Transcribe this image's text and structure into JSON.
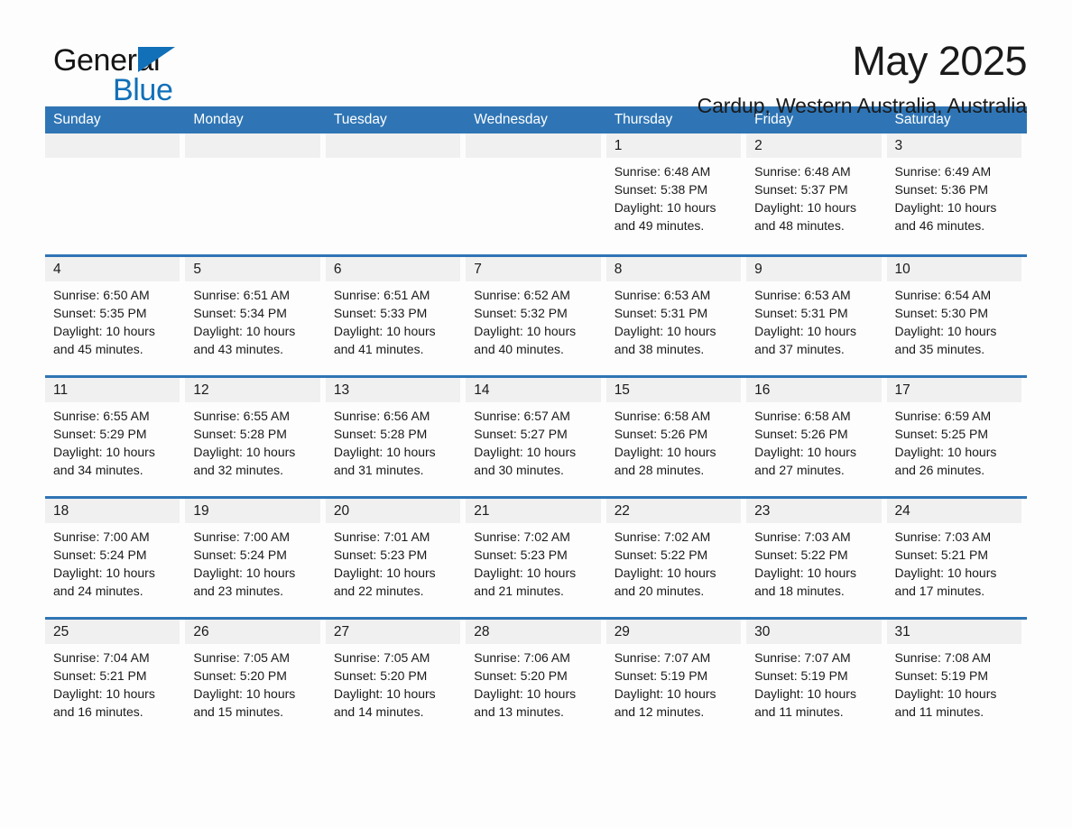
{
  "brand": {
    "name_part1": "General",
    "name_part2": "Blue",
    "logo_icon": "triangle-icon",
    "accent_color": "#1170b8"
  },
  "header": {
    "month_title": "May 2025",
    "location": "Cardup, Western Australia, Australia"
  },
  "calendar": {
    "header_bg_color": "#2f75b5",
    "day_band_color": "#f0f0f0",
    "weekdays": [
      "Sunday",
      "Monday",
      "Tuesday",
      "Wednesday",
      "Thursday",
      "Friday",
      "Saturday"
    ],
    "weeks": [
      [
        {
          "empty": true
        },
        {
          "empty": true
        },
        {
          "empty": true
        },
        {
          "empty": true
        },
        {
          "day": "1",
          "sunrise": "Sunrise: 6:48 AM",
          "sunset": "Sunset: 5:38 PM",
          "daylight_line1": "Daylight: 10 hours",
          "daylight_line2": "and 49 minutes."
        },
        {
          "day": "2",
          "sunrise": "Sunrise: 6:48 AM",
          "sunset": "Sunset: 5:37 PM",
          "daylight_line1": "Daylight: 10 hours",
          "daylight_line2": "and 48 minutes."
        },
        {
          "day": "3",
          "sunrise": "Sunrise: 6:49 AM",
          "sunset": "Sunset: 5:36 PM",
          "daylight_line1": "Daylight: 10 hours",
          "daylight_line2": "and 46 minutes."
        }
      ],
      [
        {
          "day": "4",
          "sunrise": "Sunrise: 6:50 AM",
          "sunset": "Sunset: 5:35 PM",
          "daylight_line1": "Daylight: 10 hours",
          "daylight_line2": "and 45 minutes."
        },
        {
          "day": "5",
          "sunrise": "Sunrise: 6:51 AM",
          "sunset": "Sunset: 5:34 PM",
          "daylight_line1": "Daylight: 10 hours",
          "daylight_line2": "and 43 minutes."
        },
        {
          "day": "6",
          "sunrise": "Sunrise: 6:51 AM",
          "sunset": "Sunset: 5:33 PM",
          "daylight_line1": "Daylight: 10 hours",
          "daylight_line2": "and 41 minutes."
        },
        {
          "day": "7",
          "sunrise": "Sunrise: 6:52 AM",
          "sunset": "Sunset: 5:32 PM",
          "daylight_line1": "Daylight: 10 hours",
          "daylight_line2": "and 40 minutes."
        },
        {
          "day": "8",
          "sunrise": "Sunrise: 6:53 AM",
          "sunset": "Sunset: 5:31 PM",
          "daylight_line1": "Daylight: 10 hours",
          "daylight_line2": "and 38 minutes."
        },
        {
          "day": "9",
          "sunrise": "Sunrise: 6:53 AM",
          "sunset": "Sunset: 5:31 PM",
          "daylight_line1": "Daylight: 10 hours",
          "daylight_line2": "and 37 minutes."
        },
        {
          "day": "10",
          "sunrise": "Sunrise: 6:54 AM",
          "sunset": "Sunset: 5:30 PM",
          "daylight_line1": "Daylight: 10 hours",
          "daylight_line2": "and 35 minutes."
        }
      ],
      [
        {
          "day": "11",
          "sunrise": "Sunrise: 6:55 AM",
          "sunset": "Sunset: 5:29 PM",
          "daylight_line1": "Daylight: 10 hours",
          "daylight_line2": "and 34 minutes."
        },
        {
          "day": "12",
          "sunrise": "Sunrise: 6:55 AM",
          "sunset": "Sunset: 5:28 PM",
          "daylight_line1": "Daylight: 10 hours",
          "daylight_line2": "and 32 minutes."
        },
        {
          "day": "13",
          "sunrise": "Sunrise: 6:56 AM",
          "sunset": "Sunset: 5:28 PM",
          "daylight_line1": "Daylight: 10 hours",
          "daylight_line2": "and 31 minutes."
        },
        {
          "day": "14",
          "sunrise": "Sunrise: 6:57 AM",
          "sunset": "Sunset: 5:27 PM",
          "daylight_line1": "Daylight: 10 hours",
          "daylight_line2": "and 30 minutes."
        },
        {
          "day": "15",
          "sunrise": "Sunrise: 6:58 AM",
          "sunset": "Sunset: 5:26 PM",
          "daylight_line1": "Daylight: 10 hours",
          "daylight_line2": "and 28 minutes."
        },
        {
          "day": "16",
          "sunrise": "Sunrise: 6:58 AM",
          "sunset": "Sunset: 5:26 PM",
          "daylight_line1": "Daylight: 10 hours",
          "daylight_line2": "and 27 minutes."
        },
        {
          "day": "17",
          "sunrise": "Sunrise: 6:59 AM",
          "sunset": "Sunset: 5:25 PM",
          "daylight_line1": "Daylight: 10 hours",
          "daylight_line2": "and 26 minutes."
        }
      ],
      [
        {
          "day": "18",
          "sunrise": "Sunrise: 7:00 AM",
          "sunset": "Sunset: 5:24 PM",
          "daylight_line1": "Daylight: 10 hours",
          "daylight_line2": "and 24 minutes."
        },
        {
          "day": "19",
          "sunrise": "Sunrise: 7:00 AM",
          "sunset": "Sunset: 5:24 PM",
          "daylight_line1": "Daylight: 10 hours",
          "daylight_line2": "and 23 minutes."
        },
        {
          "day": "20",
          "sunrise": "Sunrise: 7:01 AM",
          "sunset": "Sunset: 5:23 PM",
          "daylight_line1": "Daylight: 10 hours",
          "daylight_line2": "and 22 minutes."
        },
        {
          "day": "21",
          "sunrise": "Sunrise: 7:02 AM",
          "sunset": "Sunset: 5:23 PM",
          "daylight_line1": "Daylight: 10 hours",
          "daylight_line2": "and 21 minutes."
        },
        {
          "day": "22",
          "sunrise": "Sunrise: 7:02 AM",
          "sunset": "Sunset: 5:22 PM",
          "daylight_line1": "Daylight: 10 hours",
          "daylight_line2": "and 20 minutes."
        },
        {
          "day": "23",
          "sunrise": "Sunrise: 7:03 AM",
          "sunset": "Sunset: 5:22 PM",
          "daylight_line1": "Daylight: 10 hours",
          "daylight_line2": "and 18 minutes."
        },
        {
          "day": "24",
          "sunrise": "Sunrise: 7:03 AM",
          "sunset": "Sunset: 5:21 PM",
          "daylight_line1": "Daylight: 10 hours",
          "daylight_line2": "and 17 minutes."
        }
      ],
      [
        {
          "day": "25",
          "sunrise": "Sunrise: 7:04 AM",
          "sunset": "Sunset: 5:21 PM",
          "daylight_line1": "Daylight: 10 hours",
          "daylight_line2": "and 16 minutes."
        },
        {
          "day": "26",
          "sunrise": "Sunrise: 7:05 AM",
          "sunset": "Sunset: 5:20 PM",
          "daylight_line1": "Daylight: 10 hours",
          "daylight_line2": "and 15 minutes."
        },
        {
          "day": "27",
          "sunrise": "Sunrise: 7:05 AM",
          "sunset": "Sunset: 5:20 PM",
          "daylight_line1": "Daylight: 10 hours",
          "daylight_line2": "and 14 minutes."
        },
        {
          "day": "28",
          "sunrise": "Sunrise: 7:06 AM",
          "sunset": "Sunset: 5:20 PM",
          "daylight_line1": "Daylight: 10 hours",
          "daylight_line2": "and 13 minutes."
        },
        {
          "day": "29",
          "sunrise": "Sunrise: 7:07 AM",
          "sunset": "Sunset: 5:19 PM",
          "daylight_line1": "Daylight: 10 hours",
          "daylight_line2": "and 12 minutes."
        },
        {
          "day": "30",
          "sunrise": "Sunrise: 7:07 AM",
          "sunset": "Sunset: 5:19 PM",
          "daylight_line1": "Daylight: 10 hours",
          "daylight_line2": "and 11 minutes."
        },
        {
          "day": "31",
          "sunrise": "Sunrise: 7:08 AM",
          "sunset": "Sunset: 5:19 PM",
          "daylight_line1": "Daylight: 10 hours",
          "daylight_line2": "and 11 minutes."
        }
      ]
    ]
  }
}
